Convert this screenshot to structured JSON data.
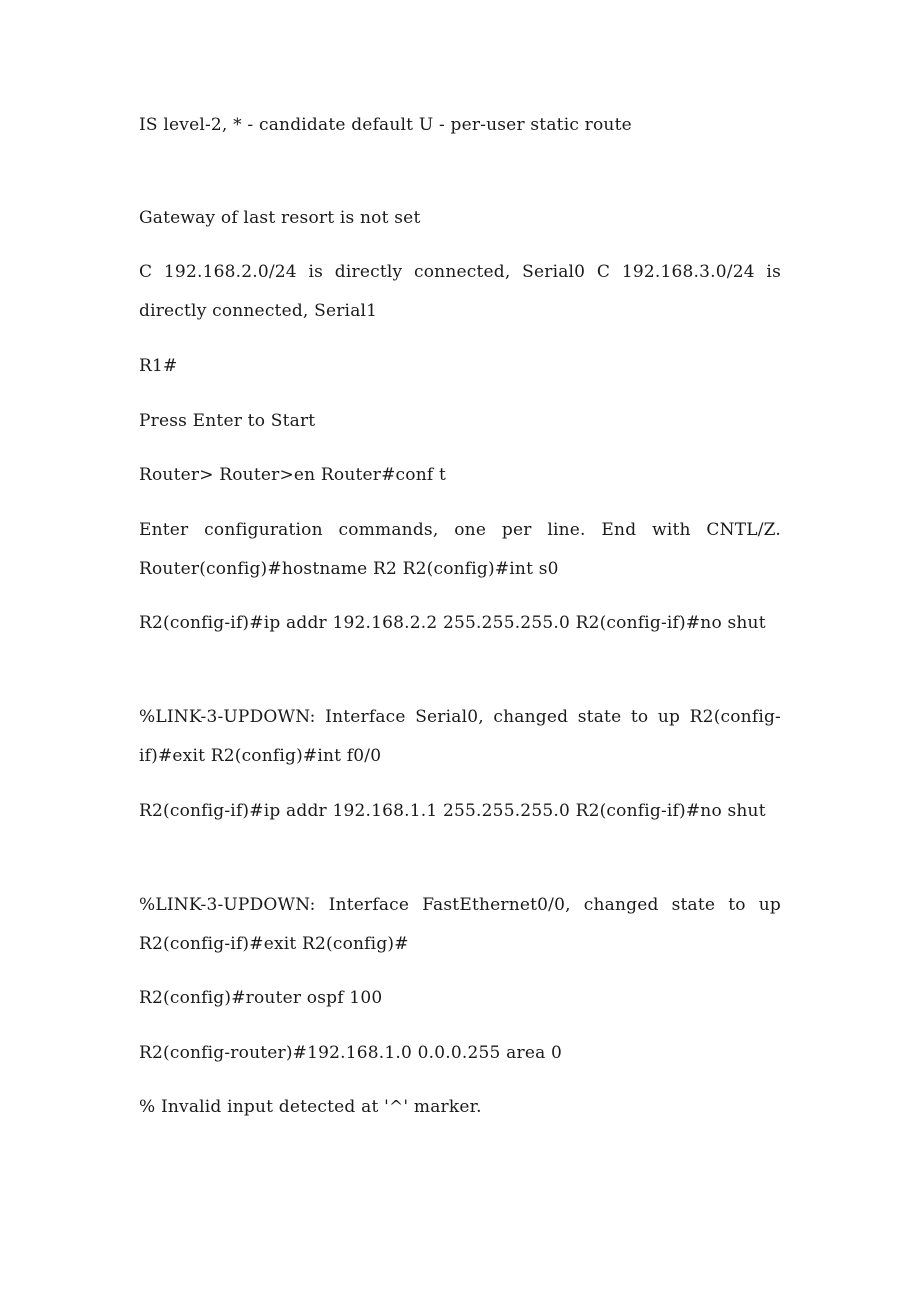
{
  "document": {
    "paragraphs": [
      {
        "id": "p1",
        "text": "IS level-2, * - candidate default         U - per-user static route"
      },
      {
        "id": "p2",
        "text": "Gateway of last resort is not set"
      },
      {
        "id": "p3",
        "text": "C          192.168.2.0/24 is directly connected, Serial0 C 192.168.3.0/24 is directly connected, Serial1"
      },
      {
        "id": "p4",
        "text": "R1#"
      },
      {
        "id": "p5",
        "text": "Press Enter to Start"
      },
      {
        "id": "p6",
        "text": "Router> Router>en Router#conf t"
      },
      {
        "id": "p7",
        "text": "Enter configuration commands, one per line. End with CNTL/Z. Router(config)#hostname R2 R2(config)#int s0"
      },
      {
        "id": "p8",
        "text": "R2(config-if)#ip addr 192.168.2.2 255.255.255.0 R2(config-if)#no shut"
      },
      {
        "id": "p9",
        "text": "%LINK-3-UPDOWN: Interface Serial0, changed state to up R2(config-if)#exit R2(config)#int f0/0"
      },
      {
        "id": "p10",
        "text": "R2(config-if)#ip addr 192.168.1.1 255.255.255.0 R2(config-if)#no shut"
      },
      {
        "id": "p11",
        "text": "%LINK-3-UPDOWN: Interface FastEthernet0/0, changed state to up R2(config-if)#exit R2(config)#"
      },
      {
        "id": "p12",
        "text": "R2(config)#router ospf 100"
      },
      {
        "id": "p13",
        "text": "R2(config-router)#192.168.1.0 0.0.0.255 area 0"
      },
      {
        "id": "p14",
        "text": "% Invalid input detected at '^' marker."
      }
    ]
  }
}
